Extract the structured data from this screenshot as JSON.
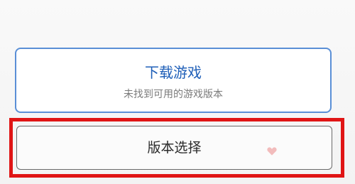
{
  "download_card": {
    "title": "下载游戏",
    "subtitle": "未找到可用的游戏版本"
  },
  "version_select": {
    "label": "版本选择"
  },
  "colors": {
    "accent_blue": "#1f5fb8",
    "card_border": "#5a8fd6",
    "highlight_red": "#e01515"
  },
  "watermark": {
    "icon": "heart-logo-icon"
  }
}
